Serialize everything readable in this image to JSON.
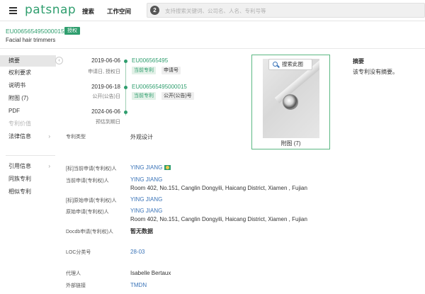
{
  "topbar": {
    "logo": "patsnap",
    "nav": [
      "搜索",
      "工作空间"
    ],
    "search_badge": "2",
    "search_placeholder": "支持搜索关键词、公司名、人名、专利号等"
  },
  "patent": {
    "number": "EU006565495000015",
    "status": "授权",
    "title": "Facial hair trimmers"
  },
  "sidebar": {
    "items": [
      {
        "label": "摘要",
        "active": true
      },
      {
        "label": "权利要求"
      },
      {
        "label": "说明书"
      },
      {
        "label": "附图 (7)"
      },
      {
        "label": "PDF"
      },
      {
        "label": "专利价值",
        "disabled": true
      },
      {
        "label": "法律信息",
        "chevron": "›"
      },
      {
        "label": "引用信息",
        "chevron": "›"
      },
      {
        "label": "同族专利"
      },
      {
        "label": "相似专利"
      }
    ],
    "collapse_glyph": "‹"
  },
  "timeline": [
    {
      "date": "2019-06-06",
      "sub": "申请日, 授权日",
      "number": "EU006565495",
      "tags": [
        "当前专利",
        "申请号"
      ]
    },
    {
      "date": "2019-06-18",
      "sub": "公开(公告)日",
      "number": "EU006565495000015",
      "tags": [
        "当前专利",
        "公开(公告)号"
      ]
    },
    {
      "date": "2024-06-06",
      "sub": "预估到期日"
    }
  ],
  "fields": {
    "patent_type_label": "专利类型",
    "patent_type_value": "外观设计",
    "std_current_applicant_label": "[标]当前申请(专利权)人",
    "std_current_applicant_value": "YING JIANG",
    "current_applicant_label": "当前申请(专利权)人",
    "current_applicant_name": "YING JIANG",
    "current_applicant_address": "Room 402, No.151, Canglin Dongyili, Haicang District, Xiamen , Fujian",
    "std_original_applicant_label": "[标]原始申请(专利权)人",
    "std_original_applicant_value": "YING JIANG",
    "original_applicant_label": "原始申请(专利权)人",
    "original_applicant_name": "YING JIANG",
    "original_applicant_address": "Room 402, No.151, Canglin Dongyili, Haicang District, Xiamen , Fujian",
    "docdb_label": "Docdb申请(专利权)人",
    "docdb_value": "暂无数据",
    "loc_label": "LOC分类号",
    "loc_value": "28-03",
    "agent_label": "代理人",
    "agent_value": "Isabelle Bertaux",
    "external_label": "外部链接",
    "external_value": "TMDN"
  },
  "figure": {
    "search_button": "搜索此图",
    "caption": "附图 (7)"
  },
  "abstract": {
    "title": "摘要",
    "text": "该专利没有摘要。"
  }
}
